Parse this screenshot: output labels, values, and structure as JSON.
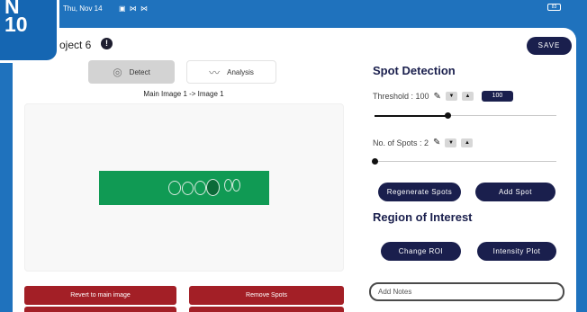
{
  "badge": {
    "line1": "N",
    "line2": "10"
  },
  "status_bar": {
    "date": "Thu, Nov 14",
    "icons": "▣ ⋈ ⋈",
    "battery": "83"
  },
  "header": {
    "project_title": "roject 6",
    "info_icon": "info-icon",
    "save_label": "SAVE"
  },
  "tabs": [
    {
      "label": "Detect",
      "icon": "target-icon",
      "active": true
    },
    {
      "label": "Analysis",
      "icon": "chart-line-icon",
      "active": false
    }
  ],
  "image_caption": "Main Image 1 -> Image 1",
  "spot_detection": {
    "title": "Spot Detection",
    "threshold": {
      "label": "Threshold : 100",
      "value": "100",
      "slider_fraction": 0.4
    },
    "spots": {
      "label": "No. of Spots : 2",
      "slider_fraction": 0.0
    },
    "regenerate_label": "Regenerate Spots",
    "add_spot_label": "Add Spot"
  },
  "roi": {
    "title": "Region of Interest",
    "change_label": "Change ROI",
    "intensity_label": "Intensity Plot"
  },
  "notes": {
    "placeholder": "Add Notes"
  },
  "bottom_buttons": {
    "revert_label": "Revert to main image",
    "remove_label": "Remove Spots"
  },
  "colors": {
    "navy": "#1a1f4d",
    "red": "#a31f26",
    "strip_green": "#109a54",
    "frame_blue": "#1f72bd"
  }
}
